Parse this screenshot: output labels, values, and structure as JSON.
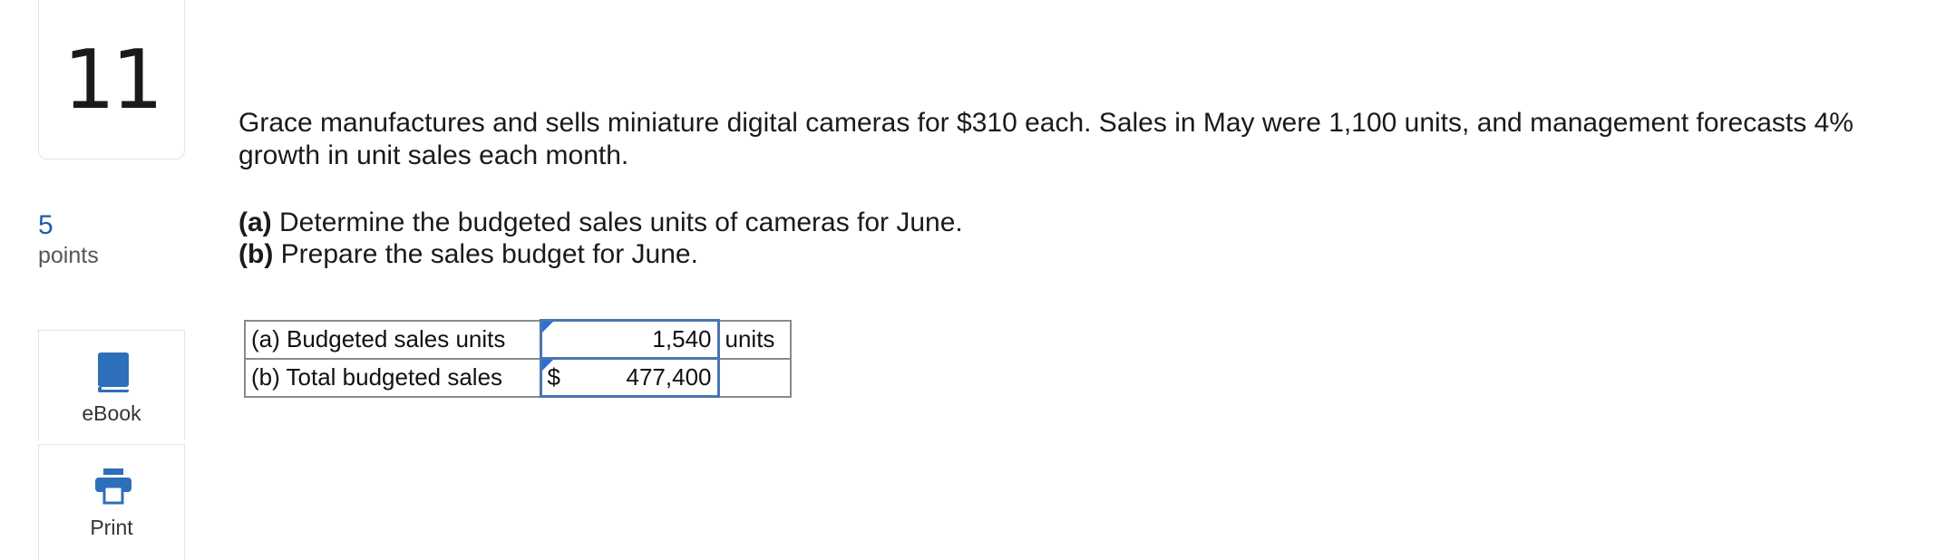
{
  "question": {
    "number": "11",
    "points_value": "5",
    "points_label": "points"
  },
  "tools": {
    "ebook_label": "eBook",
    "print_label": "Print"
  },
  "prompt": {
    "text": "Grace manufactures and sells miniature digital cameras for $310 each. Sales in May were 1,100 units, and management forecasts 4% growth in unit sales each month.",
    "part_a_tag": "(a)",
    "part_a_text": " Determine the budgeted sales units of cameras for June.",
    "part_b_tag": "(b)",
    "part_b_text": " Prepare the sales budget for June."
  },
  "answer_table": {
    "row_a": {
      "label": "(a) Budgeted sales units",
      "prefix": "",
      "value": "1,540",
      "unit": "units"
    },
    "row_b": {
      "label": "(b) Total budgeted sales",
      "prefix": "$",
      "value": "477,400",
      "unit": ""
    }
  },
  "colors": {
    "accent_blue": "#1f5da8",
    "input_border": "#4a76b0",
    "icon_blue": "#2d6fb8"
  }
}
